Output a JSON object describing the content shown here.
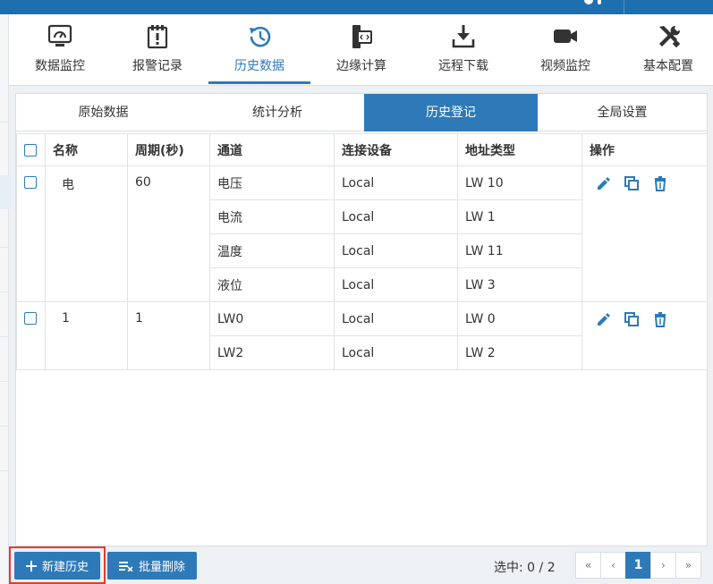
{
  "nav": {
    "items": [
      {
        "label": "数据监控",
        "icon": "monitor-gauge-icon"
      },
      {
        "label": "报警记录",
        "icon": "alarm-clipboard-icon"
      },
      {
        "label": "历史数据",
        "icon": "history-clock-icon",
        "active": true
      },
      {
        "label": "边缘计算",
        "icon": "edge-compute-icon"
      },
      {
        "label": "远程下载",
        "icon": "download-icon"
      },
      {
        "label": "视频监控",
        "icon": "video-camera-icon"
      },
      {
        "label": "基本配置",
        "icon": "tools-icon"
      }
    ]
  },
  "subtabs": [
    {
      "label": "原始数据"
    },
    {
      "label": "统计分析"
    },
    {
      "label": "历史登记",
      "active": true
    },
    {
      "label": "全局设置"
    }
  ],
  "table": {
    "headers": {
      "name": "名称",
      "period": "周期(秒)",
      "channel": "通道",
      "device": "连接设备",
      "addr_type": "地址类型",
      "ops": "操作"
    },
    "groups": [
      {
        "name": "电",
        "period": "60",
        "rows": [
          {
            "channel": "电压",
            "device": "Local",
            "addr_type": "LW 10"
          },
          {
            "channel": "电流",
            "device": "Local",
            "addr_type": "LW 1"
          },
          {
            "channel": "温度",
            "device": "Local",
            "addr_type": "LW 11"
          },
          {
            "channel": "液位",
            "device": "Local",
            "addr_type": "LW 3"
          }
        ]
      },
      {
        "name": "1",
        "period": "1",
        "rows": [
          {
            "channel": "LW0",
            "device": "Local",
            "addr_type": "LW 0"
          },
          {
            "channel": "LW2",
            "device": "Local",
            "addr_type": "LW 2"
          }
        ]
      }
    ]
  },
  "footer": {
    "new_button": "新建历史",
    "batch_delete_button": "批量删除",
    "selected_text": "选中: 0 / 2",
    "pager": {
      "first": "«",
      "prev": "‹",
      "current": "1",
      "next": "›",
      "last": "»"
    }
  },
  "colors": {
    "accent": "#2e7ab8",
    "topbar": "#1e6fb0",
    "highlight_border": "#e53935"
  }
}
